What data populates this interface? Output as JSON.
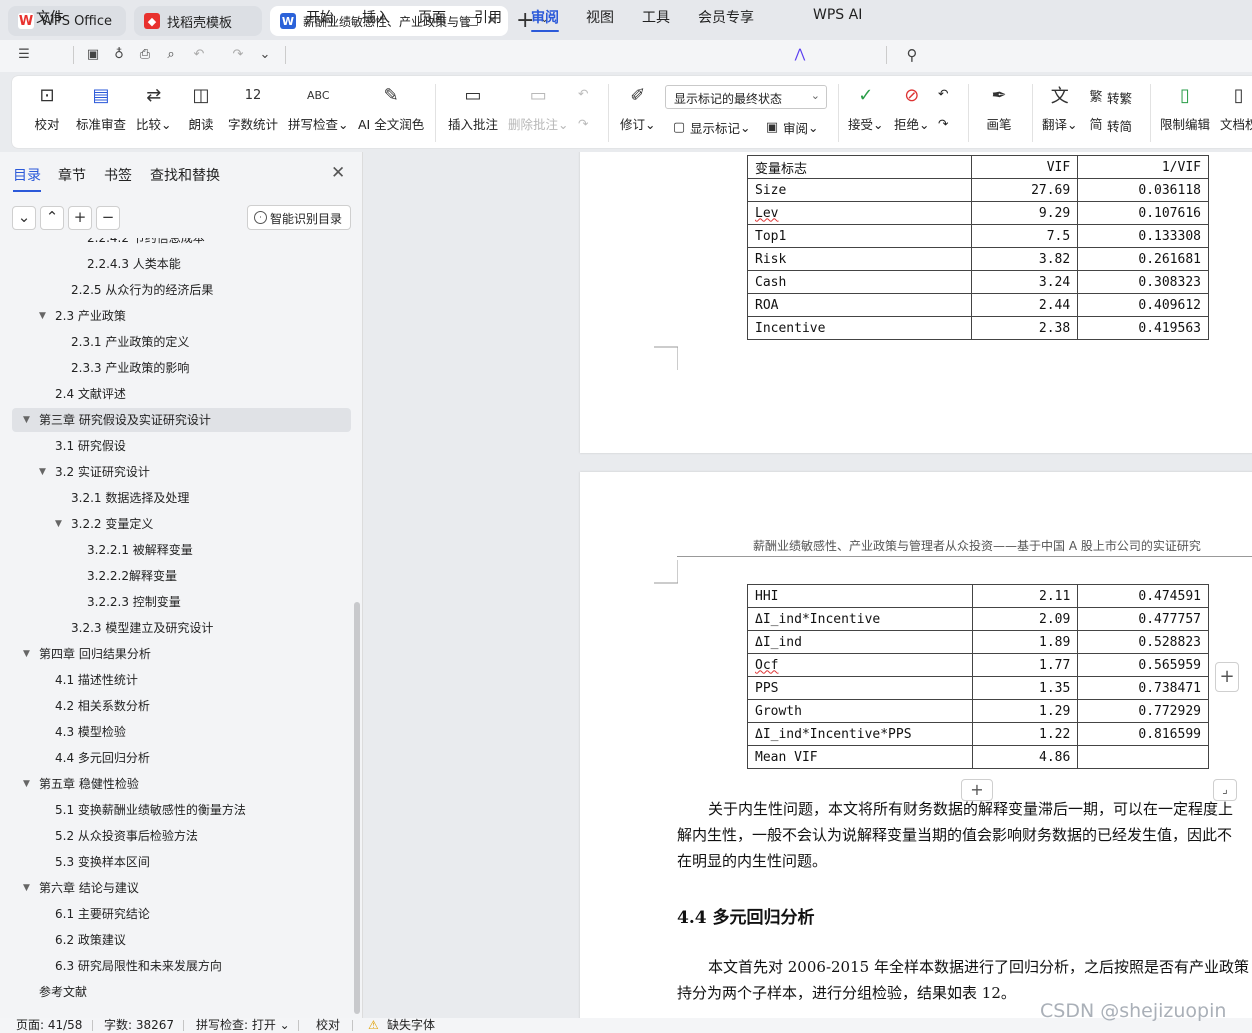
{
  "tabs": [
    {
      "label": "WPS Office",
      "icon": "wps-logo-icon"
    },
    {
      "label": "找稻壳模板",
      "icon": "docer-icon"
    },
    {
      "label": "薪酬业绩敏感性、产业政策与管",
      "icon": "word-doc-icon"
    }
  ],
  "menu": {
    "file": "文件",
    "items": [
      "开始",
      "插入",
      "页面",
      "引用",
      "审阅",
      "视图",
      "工具",
      "会员专享",
      "WPS AI"
    ],
    "active": "审阅"
  },
  "ribbon": {
    "proofread": "校对",
    "standard_review": "标准审查",
    "compare": "比较",
    "read_aloud": "朗读",
    "word_count": "字数统计",
    "spell_check": "拼写检查",
    "ai_polish": "AI 全文润色",
    "insert_comment": "插入批注",
    "delete_comment": "删除批注",
    "track_changes": "修订",
    "markup_mode": "显示标记的最终状态",
    "show_markup": "显示标记",
    "review_pane": "审阅",
    "accept": "接受",
    "reject": "拒绝",
    "ink": "画笔",
    "translate": "翻译",
    "to_traditional": "转繁",
    "to_simplified": "转简",
    "restrict_edit": "限制编辑",
    "doc_permission": "文档权"
  },
  "nav": {
    "tabs": [
      "目录",
      "章节",
      "书签",
      "查找和替换"
    ],
    "smart_toc": "智能识别目录",
    "toc": [
      {
        "label": "2.2.4.2  节约信息成本",
        "level": 4,
        "caret": ""
      },
      {
        "label": "2.2.4.3  人类本能",
        "level": 4,
        "caret": ""
      },
      {
        "label": "2.2.5  从众行为的经济后果",
        "level": 3,
        "caret": ""
      },
      {
        "label": "2.3  产业政策",
        "level": 2,
        "caret": "▼"
      },
      {
        "label": "2.3.1  产业政策的定义",
        "level": 3,
        "caret": ""
      },
      {
        "label": "2.3.3  产业政策的影响",
        "level": 3,
        "caret": ""
      },
      {
        "label": "2.4  文献评述",
        "level": 2,
        "caret": ""
      },
      {
        "label": "第三章  研究假设及实证研究设计",
        "level": 1,
        "caret": "▼",
        "selected": true
      },
      {
        "label": "3.1  研究假设",
        "level": 2,
        "caret": ""
      },
      {
        "label": "3.2  实证研究设计",
        "level": 2,
        "caret": "▼"
      },
      {
        "label": "3.2.1  数据选择及处理",
        "level": 3,
        "caret": ""
      },
      {
        "label": "3.2.2  变量定义",
        "level": 3,
        "caret": "▼"
      },
      {
        "label": "3.2.2.1  被解释变量",
        "level": 4,
        "caret": ""
      },
      {
        "label": "3.2.2.2解释变量",
        "level": 4,
        "caret": ""
      },
      {
        "label": "3.2.2.3  控制变量",
        "level": 4,
        "caret": ""
      },
      {
        "label": "3.2.3  模型建立及研究设计",
        "level": 3,
        "caret": ""
      },
      {
        "label": "第四章  回归结果分析",
        "level": 1,
        "caret": "▼"
      },
      {
        "label": "4.1  描述性统计",
        "level": 2,
        "caret": ""
      },
      {
        "label": "4.2  相关系数分析",
        "level": 2,
        "caret": ""
      },
      {
        "label": "4.3  模型检验",
        "level": 2,
        "caret": ""
      },
      {
        "label": "4.4  多元回归分析",
        "level": 2,
        "caret": ""
      },
      {
        "label": "第五章  稳健性检验",
        "level": 1,
        "caret": "▼"
      },
      {
        "label": "5.1  变换薪酬业绩敏感性的衡量方法",
        "level": 2,
        "caret": ""
      },
      {
        "label": "5.2  从众投资事后检验方法",
        "level": 2,
        "caret": ""
      },
      {
        "label": "5.3  变换样本区间",
        "level": 2,
        "caret": ""
      },
      {
        "label": "第六章  结论与建议",
        "level": 1,
        "caret": "▼"
      },
      {
        "label": "6.1  主要研究结论",
        "level": 2,
        "caret": ""
      },
      {
        "label": "6.2  政策建议",
        "level": 2,
        "caret": ""
      },
      {
        "label": "6.3  研究局限性和未来发展方向",
        "level": 2,
        "caret": ""
      },
      {
        "label": "参考文献",
        "level": 1,
        "caret": ""
      }
    ]
  },
  "doc": {
    "table1": {
      "header": [
        "变量标志",
        "VIF",
        "1/VIF"
      ],
      "rows": [
        [
          "Size",
          "27.69",
          "0.036118"
        ],
        [
          "Lev",
          "9.29",
          "0.107616"
        ],
        [
          "Top1",
          "7.5",
          "0.133308"
        ],
        [
          "Risk",
          "3.82",
          "0.261681"
        ],
        [
          "Cash",
          "3.24",
          "0.308323"
        ],
        [
          "ROA",
          "2.44",
          "0.409612"
        ],
        [
          "Incentive",
          "2.38",
          "0.419563"
        ]
      ]
    },
    "page_header": "薪酬业绩敏感性、产业政策与管理者从众投资——基于中国 A 股上市公司的实证研究",
    "table2": {
      "rows": [
        [
          "HHI",
          "2.11",
          "0.474591"
        ],
        [
          "ΔI_ind*Incentive",
          "2.09",
          "0.477757"
        ],
        [
          "ΔI_ind",
          "1.89",
          "0.528823"
        ],
        [
          "Ocf",
          "1.77",
          "0.565959"
        ],
        [
          "PPS",
          "1.35",
          "0.738471"
        ],
        [
          "Growth",
          "1.29",
          "0.772929"
        ],
        [
          "ΔI_ind*Incentive*PPS",
          "1.22",
          "0.816599"
        ],
        [
          "Mean VIF",
          "4.86",
          ""
        ]
      ]
    },
    "para1": [
      "关于内生性问题，本文将所有财务数据的解释变量滞后一期，可以在一定程度上",
      "解内生性，一般不会认为说解释变量当期的值会影响财务数据的已经发生值，因此不",
      "在明显的内生性问题。"
    ],
    "heading": "4.4  多元回归分析",
    "para2": [
      "本文首先对 2006-2015 年全样本数据进行了回归分析，之后按照是否有产业政策",
      "持分为两个子样本，进行分组检验，结果如表 12。"
    ]
  },
  "status": {
    "page": "页面: 41/58",
    "words": "字数: 38267",
    "spell": "拼写检查: 打开",
    "proof": "校对",
    "font_missing": "缺失字体"
  },
  "watermark": "CSDN @shejizuopin",
  "colors": {
    "accent": "#2b59d9",
    "wps_red": "#e8312e",
    "word_blue": "#2b62d9"
  }
}
